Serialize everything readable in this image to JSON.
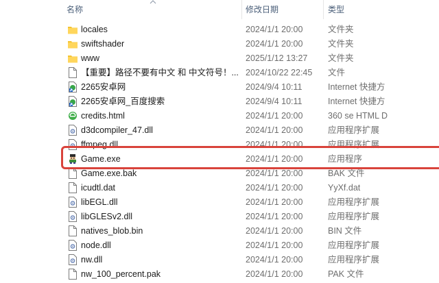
{
  "columns": {
    "name": "名称",
    "date": "修改日期",
    "type": "类型"
  },
  "accent": {
    "highlight": "#d9433b",
    "folder": "#f4c430"
  },
  "files": [
    {
      "icon": "folder-icon",
      "name": "locales",
      "date": "2024/1/1 20:00",
      "type": "文件夹"
    },
    {
      "icon": "folder-icon",
      "name": "swiftshader",
      "date": "2024/1/1 20:00",
      "type": "文件夹"
    },
    {
      "icon": "folder-icon",
      "name": "www",
      "date": "2025/1/12 13:27",
      "type": "文件夹"
    },
    {
      "icon": "blank-file-icon",
      "name": "【重要】路径不要有中文 和 中文符号！...",
      "date": "2024/10/22 22:45",
      "type": "文件"
    },
    {
      "icon": "internet-shortcut-icon",
      "name": "2265安卓网",
      "date": "2024/9/4 10:11",
      "type": "Internet 快捷方"
    },
    {
      "icon": "internet-shortcut-icon",
      "name": "2265安卓网_百度搜索",
      "date": "2024/9/4 10:11",
      "type": "Internet 快捷方"
    },
    {
      "icon": "html-file-icon",
      "name": "credits.html",
      "date": "2024/1/1 20:00",
      "type": "360 se HTML D"
    },
    {
      "icon": "dll-file-icon",
      "name": "d3dcompiler_47.dll",
      "date": "2024/1/1 20:00",
      "type": "应用程序扩展"
    },
    {
      "icon": "dll-file-icon",
      "name": "ffmpeg.dll",
      "date": "2024/1/1 20:00",
      "type": "应用程序扩展"
    },
    {
      "icon": "game-exe-icon",
      "name": "Game.exe",
      "date": "2024/1/1 20:00",
      "type": "应用程序"
    },
    {
      "icon": "blank-file-icon",
      "name": "Game.exe.bak",
      "date": "2024/1/1 20:00",
      "type": "BAK 文件"
    },
    {
      "icon": "blank-file-icon",
      "name": "icudtl.dat",
      "date": "2024/1/1 20:00",
      "type": "YyXf.dat"
    },
    {
      "icon": "dll-file-icon",
      "name": "libEGL.dll",
      "date": "2024/1/1 20:00",
      "type": "应用程序扩展"
    },
    {
      "icon": "dll-file-icon",
      "name": "libGLESv2.dll",
      "date": "2024/1/1 20:00",
      "type": "应用程序扩展"
    },
    {
      "icon": "blank-file-icon",
      "name": "natives_blob.bin",
      "date": "2024/1/1 20:00",
      "type": "BIN 文件"
    },
    {
      "icon": "dll-file-icon",
      "name": "node.dll",
      "date": "2024/1/1 20:00",
      "type": "应用程序扩展"
    },
    {
      "icon": "dll-file-icon",
      "name": "nw.dll",
      "date": "2024/1/1 20:00",
      "type": "应用程序扩展"
    },
    {
      "icon": "blank-file-icon",
      "name": "nw_100_percent.pak",
      "date": "2024/1/1 20:00",
      "type": "PAK 文件"
    }
  ]
}
